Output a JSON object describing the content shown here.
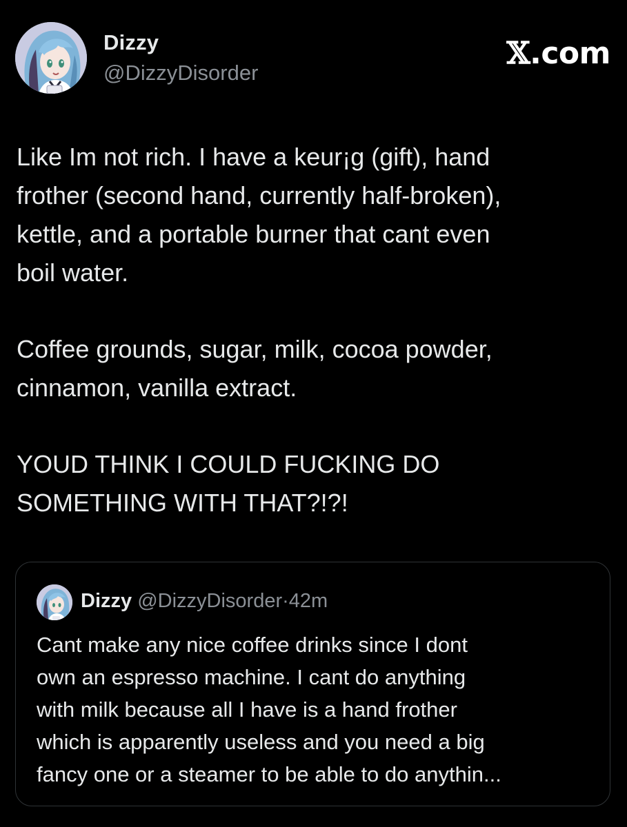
{
  "author": {
    "name": "Dizzy",
    "handle": "@DizzyDisorder"
  },
  "site_mark": {
    "glyph": "𝕏",
    "text": ".com"
  },
  "post": {
    "paragraphs": [
      "Like Im not rich. I have a keur¡g (gift), hand\nfrother (second hand, currently half-broken),\nkettle, and a portable burner that cant even\nboil water.",
      "Coffee grounds, sugar, milk, cocoa powder,\ncinnamon, vanilla extract.",
      "YOUD THINK I COULD FUCKING DO\nSOMETHING WITH THAT?!?!"
    ]
  },
  "quoted_post": {
    "name": "Dizzy",
    "handle": "@DizzyDisorder",
    "separator": "·",
    "time": "42m",
    "text": "Cant make any nice coffee drinks since I dont\nown an espresso machine. I cant do anything\nwith milk because all I have is a hand frother\nwhich is apparently useless and you need a big\nfancy one or a steamer to be able to do anythin..."
  },
  "colors": {
    "background": "#000000",
    "text_primary": "#e7e9ea",
    "text_secondary": "#8b9096",
    "border": "#2f3336"
  },
  "icons": {
    "avatar": "anime-avatar-icon",
    "logo": "x-logo-icon"
  }
}
